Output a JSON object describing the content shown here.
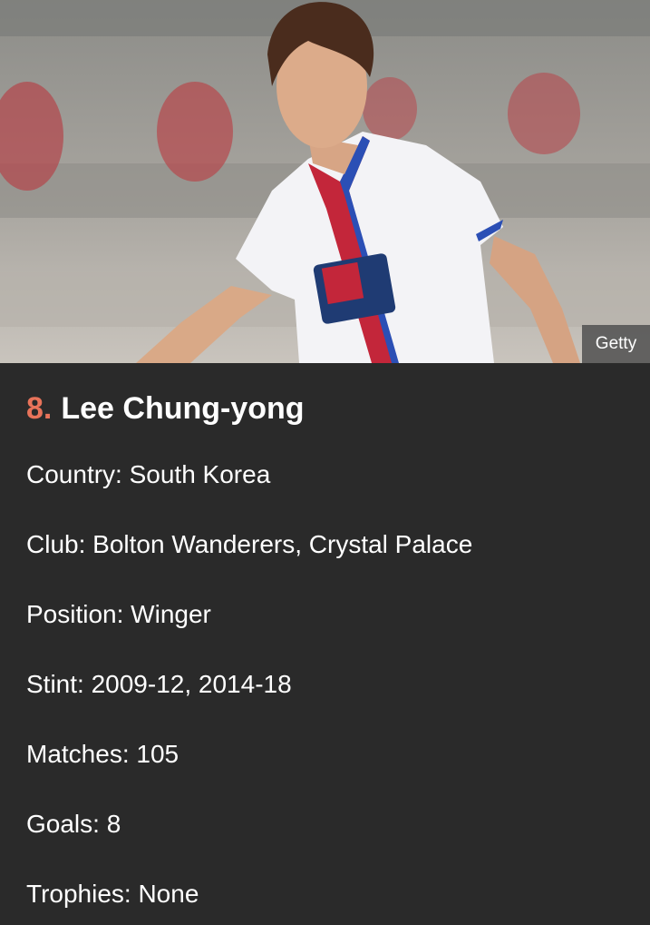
{
  "image": {
    "credit": "Getty",
    "description_icon": "footballer-photo-icon"
  },
  "entry": {
    "rank": "8.",
    "name": "Lee Chung-yong",
    "rank_color": "#e8735a"
  },
  "facts": [
    "Country: South Korea",
    "Club: Bolton Wanderers, Crystal Palace",
    "Position: Winger",
    "Stint: 2009-12, 2014-18",
    "Matches: 105",
    "Goals: 8",
    "Trophies: None"
  ],
  "colors": {
    "background": "#2a2a2a",
    "text": "#ffffff",
    "accent": "#e8735a"
  }
}
